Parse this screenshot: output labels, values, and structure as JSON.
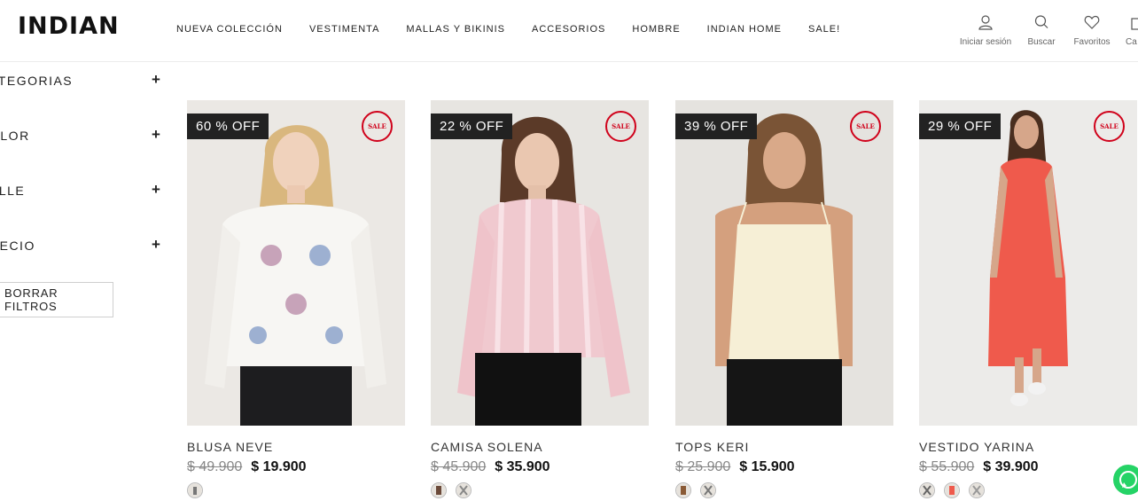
{
  "brand": "INDIAN",
  "nav": [
    "NUEVA COLECCIÓN",
    "VESTIMENTA",
    "MALLAS Y BIKINIS",
    "ACCESORIOS",
    "HOMBRE",
    "INDIAN HOME",
    "SALE!"
  ],
  "header_actions": {
    "login": "Iniciar sesión",
    "search": "Buscar",
    "favorites": "Favoritos",
    "cart": "Ca"
  },
  "filters": [
    "ATEGORIAS",
    "OLOR",
    "ALLE",
    "RECIO"
  ],
  "clear_filters": "BORRAR FILTROS",
  "sale_badge": "SALE",
  "products": [
    {
      "name": "BLUSA NEVE",
      "discount": "60 % OFF",
      "old_price": "$ 49.900",
      "price": "$ 19.900",
      "swatch_count": 1
    },
    {
      "name": "CAMISA SOLENA",
      "discount": "22 % OFF",
      "old_price": "$ 45.900",
      "price": "$ 35.900",
      "swatch_count": 2
    },
    {
      "name": "TOPS KERI",
      "discount": "39 % OFF",
      "old_price": "$ 25.900",
      "price": "$ 15.900",
      "swatch_count": 2
    },
    {
      "name": "VESTIDO YARINA",
      "discount": "29 % OFF",
      "old_price": "$ 55.900",
      "price": "$ 39.900",
      "swatch_count": 3
    }
  ],
  "colors": {
    "sale_red": "#d0021b",
    "badge_bg": "#222222",
    "whatsapp": "#25d366"
  }
}
